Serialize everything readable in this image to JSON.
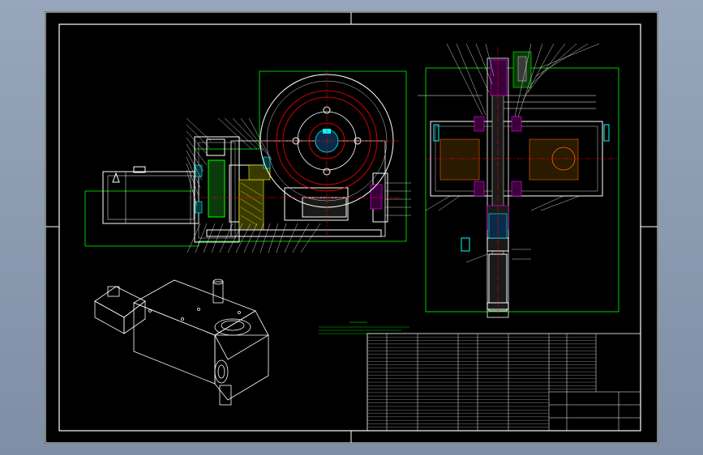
{
  "drawing": {
    "title": "",
    "colors": {
      "background": "#000000",
      "border": "#ffffff",
      "outline": "#00ff00",
      "centerline": "#ff0000",
      "magenta": "#ff00ff",
      "cyan": "#00ffff",
      "yellow": "#ffff00"
    }
  },
  "title_block": {
    "rows": 28,
    "label": ""
  }
}
